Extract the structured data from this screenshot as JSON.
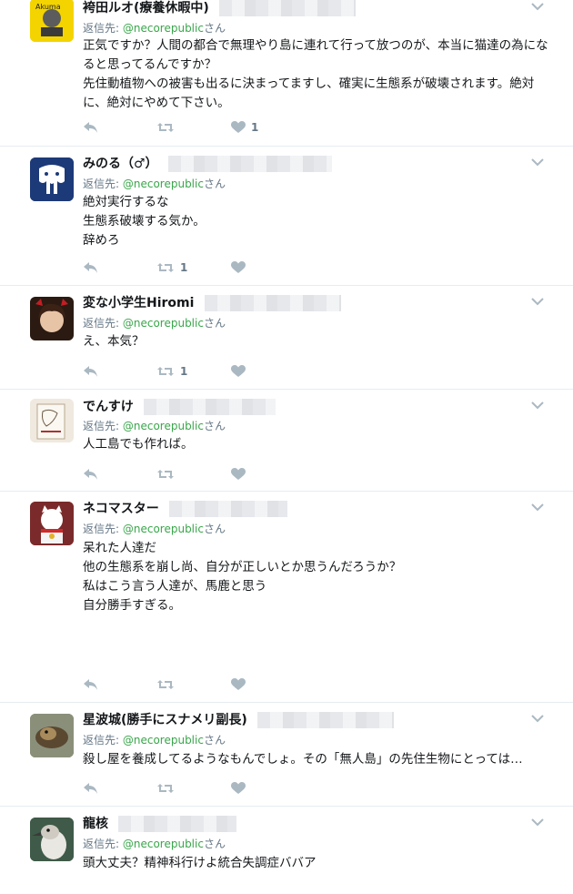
{
  "tweets": [
    {
      "name": "袴田ルオ(療養休暇中)",
      "reply_prefix": "返信先: ",
      "reply_handle": "@necorepublic",
      "reply_suffix": "さん",
      "lines": [
        "正気ですか？人間の都合で無理やり島に連れて行って放つのが、本当に猫達の為になると思ってるんですか？",
        "先住動植物への被害も出るに決まってますし、確実に生態系が破壊されます。絶対に、絶対にやめて下さい。"
      ],
      "reply_count": "",
      "retweet_count": "",
      "like_count": "1",
      "avatar_icon": "cartoon-avatar",
      "avatar_color": "#f3d400"
    },
    {
      "name": "みのる（♂）",
      "reply_prefix": "返信先: ",
      "reply_handle": "@necorepublic",
      "reply_suffix": "さん",
      "lines": [
        "絶対実行するな",
        "生態系破壊する気か。",
        "辞めろ"
      ],
      "reply_count": "",
      "retweet_count": "1",
      "like_count": "",
      "avatar_icon": "elephant-avatar",
      "avatar_color": "#1d3a78"
    },
    {
      "name": "変な小学生Hiromi",
      "reply_prefix": "返信先: ",
      "reply_handle": "@necorepublic",
      "reply_suffix": "さん",
      "lines": [
        "え、本気？"
      ],
      "reply_count": "",
      "retweet_count": "1",
      "like_count": "",
      "avatar_icon": "person-avatar",
      "avatar_color": "#c9a58a"
    },
    {
      "name": "でんすけ",
      "reply_prefix": "返信先: ",
      "reply_handle": "@necorepublic",
      "reply_suffix": "さん",
      "lines": [
        "人工島でも作れば。"
      ],
      "reply_count": "",
      "retweet_count": "",
      "like_count": "",
      "avatar_icon": "sketch-avatar",
      "avatar_color": "#e8e2d8"
    },
    {
      "name": "ネコマスター",
      "reply_prefix": "返信先: ",
      "reply_handle": "@necorepublic",
      "reply_suffix": "さん",
      "lines": [
        "呆れた人達だ",
        "",
        "他の生態系を崩し尚、自分が正しいとか思うんだろうか？",
        "",
        "私はこう言う人達が、馬鹿と思う",
        "",
        "自分勝手すぎる。"
      ],
      "reply_count": "",
      "retweet_count": "",
      "like_count": "",
      "avatar_icon": "lucky-cat-avatar",
      "avatar_color": "#b8232a"
    },
    {
      "name": "星波城(勝手にスナメリ副長)",
      "reply_prefix": "返信先: ",
      "reply_handle": "@necorepublic",
      "reply_suffix": "さん",
      "lines": [
        "殺し屋を養成してるようなもんでしょ。その「無人島」の先住生物にとっては…"
      ],
      "reply_count": "",
      "retweet_count": "",
      "like_count": "",
      "avatar_icon": "animal-photo-avatar",
      "avatar_color": "#6b5a3e"
    },
    {
      "name": "龍核",
      "reply_prefix": "返信先: ",
      "reply_handle": "@necorepublic",
      "reply_suffix": "さん",
      "lines": [
        "頭大丈夫？精神科行けよ統合失調症ババア"
      ],
      "reply_count": "",
      "retweet_count": "",
      "like_count": "",
      "avatar_icon": "bird-avatar",
      "avatar_color": "#2e4a3a"
    }
  ],
  "icons": {
    "reply": "reply-icon",
    "retweet": "retweet-icon",
    "like": "heart-icon",
    "more": "chevron-down-icon"
  },
  "colors": {
    "handle": "#3aa64b",
    "muted": "#657786",
    "divider": "#e6ecf0"
  }
}
